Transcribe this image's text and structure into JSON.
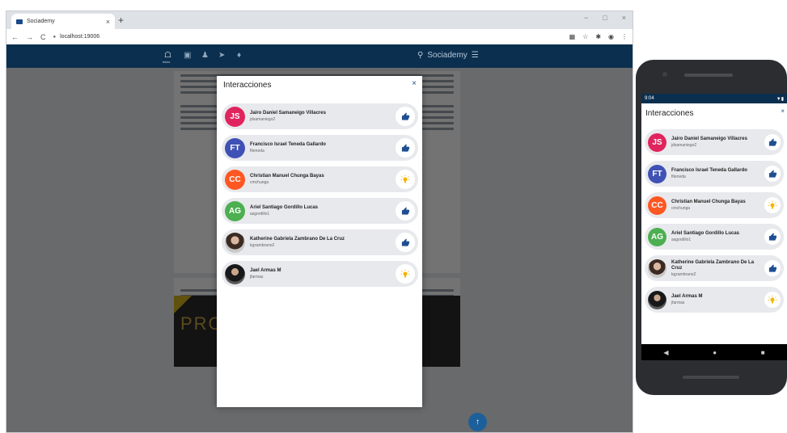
{
  "browser": {
    "tab_title": "Sociademy",
    "tab_close": "×",
    "new_tab": "+",
    "url": "localhost:19006",
    "back": "←",
    "forward": "→",
    "reload": "C",
    "menu": "⋮",
    "window_controls": [
      "−",
      "□",
      "×"
    ]
  },
  "app": {
    "home_label": "Inicio",
    "brand": "Sociademy",
    "header_color": "#0b2f4f"
  },
  "modal": {
    "title": "Interacciones",
    "close": "×",
    "items": [
      {
        "initials": "JS",
        "color": "#e0245e",
        "name": "Jairo Daniel Samaneigo Villacres",
        "username": "jdsamaniego2",
        "reaction": "like-icon"
      },
      {
        "initials": "FT",
        "color": "#3f51b5",
        "name": "Francisco Israel Teneda Gallardo",
        "username": "fiteneda",
        "reaction": "like-icon"
      },
      {
        "initials": "CC",
        "color": "#ff5722",
        "name": "Christian Manuel Chunga Bayas",
        "username": "cmchunga",
        "reaction": "idea-icon"
      },
      {
        "initials": "AG",
        "color": "#4caf50",
        "name": "Ariel Santiago Gordillo Lucas",
        "username": "asgordillo1",
        "reaction": "like-icon"
      },
      {
        "initials": "",
        "color": "photo",
        "name": "Katherine Gabriela Zambrano De La Cruz",
        "username": "kgzambrano2",
        "reaction": "like-icon"
      },
      {
        "initials": "",
        "color": "photo2",
        "name": "Jael Armas M",
        "username": "jfarmas",
        "reaction": "idea-icon"
      }
    ]
  },
  "phone": {
    "time": "9:04",
    "title": "Interacciones",
    "close": "×"
  },
  "colors": {
    "like": "#1d4f91",
    "idea": "#f5b400"
  }
}
